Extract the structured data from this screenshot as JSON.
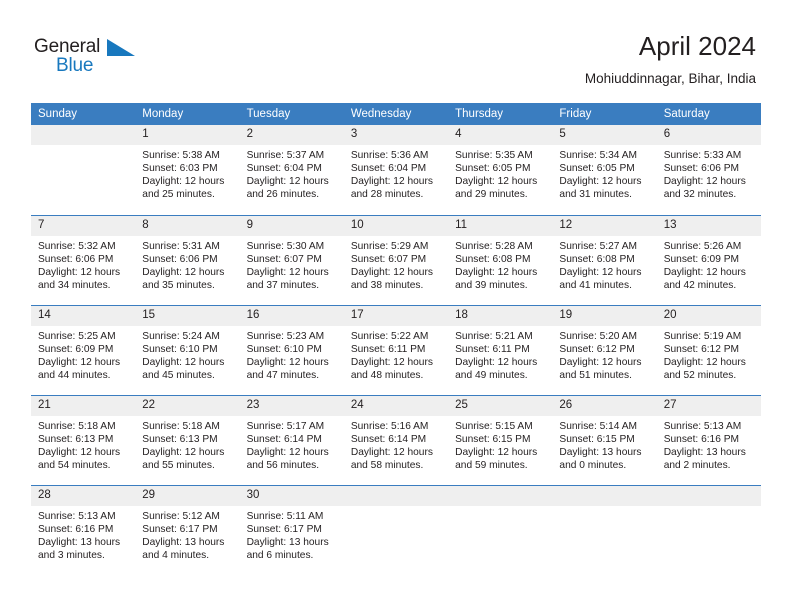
{
  "brand": {
    "name_part1": "General",
    "name_part2": "Blue",
    "flag_icon": "blue-triangle-flag-icon"
  },
  "header": {
    "title": "April 2024",
    "subtitle": "Mohiuddinnagar, Bihar, India"
  },
  "colors": {
    "header_blue": "#3a7dc0",
    "brand_blue": "#1878be",
    "daynum_bg": "#efefef",
    "text": "#231f20"
  },
  "labels": {
    "sunrise_prefix": "Sunrise:",
    "sunset_prefix": "Sunset:",
    "daylight_prefix": "Daylight:"
  },
  "weekday_headers": [
    "Sunday",
    "Monday",
    "Tuesday",
    "Wednesday",
    "Thursday",
    "Friday",
    "Saturday"
  ],
  "weeks": [
    [
      {
        "day": "",
        "blank": true
      },
      {
        "day": "1",
        "sunrise": "Sunrise: 5:38 AM",
        "sunset": "Sunset: 6:03 PM",
        "daylight_a": "Daylight: 12 hours",
        "daylight_b": "and 25 minutes."
      },
      {
        "day": "2",
        "sunrise": "Sunrise: 5:37 AM",
        "sunset": "Sunset: 6:04 PM",
        "daylight_a": "Daylight: 12 hours",
        "daylight_b": "and 26 minutes."
      },
      {
        "day": "3",
        "sunrise": "Sunrise: 5:36 AM",
        "sunset": "Sunset: 6:04 PM",
        "daylight_a": "Daylight: 12 hours",
        "daylight_b": "and 28 minutes."
      },
      {
        "day": "4",
        "sunrise": "Sunrise: 5:35 AM",
        "sunset": "Sunset: 6:05 PM",
        "daylight_a": "Daylight: 12 hours",
        "daylight_b": "and 29 minutes."
      },
      {
        "day": "5",
        "sunrise": "Sunrise: 5:34 AM",
        "sunset": "Sunset: 6:05 PM",
        "daylight_a": "Daylight: 12 hours",
        "daylight_b": "and 31 minutes."
      },
      {
        "day": "6",
        "sunrise": "Sunrise: 5:33 AM",
        "sunset": "Sunset: 6:06 PM",
        "daylight_a": "Daylight: 12 hours",
        "daylight_b": "and 32 minutes."
      }
    ],
    [
      {
        "day": "7",
        "sunrise": "Sunrise: 5:32 AM",
        "sunset": "Sunset: 6:06 PM",
        "daylight_a": "Daylight: 12 hours",
        "daylight_b": "and 34 minutes."
      },
      {
        "day": "8",
        "sunrise": "Sunrise: 5:31 AM",
        "sunset": "Sunset: 6:06 PM",
        "daylight_a": "Daylight: 12 hours",
        "daylight_b": "and 35 minutes."
      },
      {
        "day": "9",
        "sunrise": "Sunrise: 5:30 AM",
        "sunset": "Sunset: 6:07 PM",
        "daylight_a": "Daylight: 12 hours",
        "daylight_b": "and 37 minutes."
      },
      {
        "day": "10",
        "sunrise": "Sunrise: 5:29 AM",
        "sunset": "Sunset: 6:07 PM",
        "daylight_a": "Daylight: 12 hours",
        "daylight_b": "and 38 minutes."
      },
      {
        "day": "11",
        "sunrise": "Sunrise: 5:28 AM",
        "sunset": "Sunset: 6:08 PM",
        "daylight_a": "Daylight: 12 hours",
        "daylight_b": "and 39 minutes."
      },
      {
        "day": "12",
        "sunrise": "Sunrise: 5:27 AM",
        "sunset": "Sunset: 6:08 PM",
        "daylight_a": "Daylight: 12 hours",
        "daylight_b": "and 41 minutes."
      },
      {
        "day": "13",
        "sunrise": "Sunrise: 5:26 AM",
        "sunset": "Sunset: 6:09 PM",
        "daylight_a": "Daylight: 12 hours",
        "daylight_b": "and 42 minutes."
      }
    ],
    [
      {
        "day": "14",
        "sunrise": "Sunrise: 5:25 AM",
        "sunset": "Sunset: 6:09 PM",
        "daylight_a": "Daylight: 12 hours",
        "daylight_b": "and 44 minutes."
      },
      {
        "day": "15",
        "sunrise": "Sunrise: 5:24 AM",
        "sunset": "Sunset: 6:10 PM",
        "daylight_a": "Daylight: 12 hours",
        "daylight_b": "and 45 minutes."
      },
      {
        "day": "16",
        "sunrise": "Sunrise: 5:23 AM",
        "sunset": "Sunset: 6:10 PM",
        "daylight_a": "Daylight: 12 hours",
        "daylight_b": "and 47 minutes."
      },
      {
        "day": "17",
        "sunrise": "Sunrise: 5:22 AM",
        "sunset": "Sunset: 6:11 PM",
        "daylight_a": "Daylight: 12 hours",
        "daylight_b": "and 48 minutes."
      },
      {
        "day": "18",
        "sunrise": "Sunrise: 5:21 AM",
        "sunset": "Sunset: 6:11 PM",
        "daylight_a": "Daylight: 12 hours",
        "daylight_b": "and 49 minutes."
      },
      {
        "day": "19",
        "sunrise": "Sunrise: 5:20 AM",
        "sunset": "Sunset: 6:12 PM",
        "daylight_a": "Daylight: 12 hours",
        "daylight_b": "and 51 minutes."
      },
      {
        "day": "20",
        "sunrise": "Sunrise: 5:19 AM",
        "sunset": "Sunset: 6:12 PM",
        "daylight_a": "Daylight: 12 hours",
        "daylight_b": "and 52 minutes."
      }
    ],
    [
      {
        "day": "21",
        "sunrise": "Sunrise: 5:18 AM",
        "sunset": "Sunset: 6:13 PM",
        "daylight_a": "Daylight: 12 hours",
        "daylight_b": "and 54 minutes."
      },
      {
        "day": "22",
        "sunrise": "Sunrise: 5:18 AM",
        "sunset": "Sunset: 6:13 PM",
        "daylight_a": "Daylight: 12 hours",
        "daylight_b": "and 55 minutes."
      },
      {
        "day": "23",
        "sunrise": "Sunrise: 5:17 AM",
        "sunset": "Sunset: 6:14 PM",
        "daylight_a": "Daylight: 12 hours",
        "daylight_b": "and 56 minutes."
      },
      {
        "day": "24",
        "sunrise": "Sunrise: 5:16 AM",
        "sunset": "Sunset: 6:14 PM",
        "daylight_a": "Daylight: 12 hours",
        "daylight_b": "and 58 minutes."
      },
      {
        "day": "25",
        "sunrise": "Sunrise: 5:15 AM",
        "sunset": "Sunset: 6:15 PM",
        "daylight_a": "Daylight: 12 hours",
        "daylight_b": "and 59 minutes."
      },
      {
        "day": "26",
        "sunrise": "Sunrise: 5:14 AM",
        "sunset": "Sunset: 6:15 PM",
        "daylight_a": "Daylight: 13 hours",
        "daylight_b": "and 0 minutes."
      },
      {
        "day": "27",
        "sunrise": "Sunrise: 5:13 AM",
        "sunset": "Sunset: 6:16 PM",
        "daylight_a": "Daylight: 13 hours",
        "daylight_b": "and 2 minutes."
      }
    ],
    [
      {
        "day": "28",
        "sunrise": "Sunrise: 5:13 AM",
        "sunset": "Sunset: 6:16 PM",
        "daylight_a": "Daylight: 13 hours",
        "daylight_b": "and 3 minutes."
      },
      {
        "day": "29",
        "sunrise": "Sunrise: 5:12 AM",
        "sunset": "Sunset: 6:17 PM",
        "daylight_a": "Daylight: 13 hours",
        "daylight_b": "and 4 minutes."
      },
      {
        "day": "30",
        "sunrise": "Sunrise: 5:11 AM",
        "sunset": "Sunset: 6:17 PM",
        "daylight_a": "Daylight: 13 hours",
        "daylight_b": "and 6 minutes."
      },
      {
        "day": "",
        "blank": true
      },
      {
        "day": "",
        "blank": true
      },
      {
        "day": "",
        "blank": true
      },
      {
        "day": "",
        "blank": true
      }
    ]
  ]
}
